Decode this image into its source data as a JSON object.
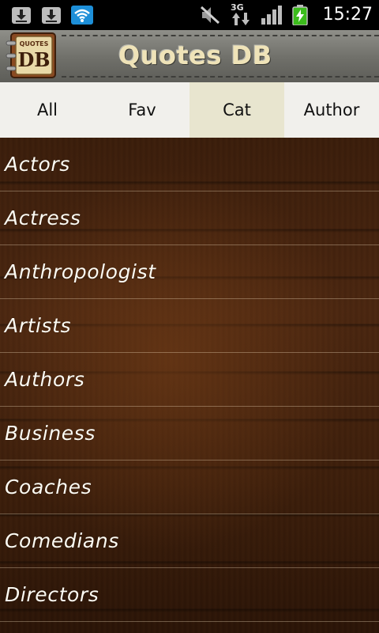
{
  "status_bar": {
    "time": "15:27",
    "network_label": "3G",
    "icons": [
      "download-icon",
      "download-icon",
      "wifi-icon",
      "mute-icon",
      "data-arrows-icon",
      "signal-icon",
      "battery-charging-icon"
    ]
  },
  "header": {
    "title": "Quotes DB",
    "logo_text_top": "QUOTES",
    "logo_text_main": "DB"
  },
  "tabs": [
    {
      "label": "All",
      "selected": false
    },
    {
      "label": "Fav",
      "selected": false
    },
    {
      "label": "Cat",
      "selected": true
    },
    {
      "label": "Author",
      "selected": false
    }
  ],
  "categories": [
    "Actors",
    "Actress",
    "Anthropologist",
    "Artists",
    "Authors",
    "Business",
    "Coaches",
    "Comedians",
    "Directors"
  ],
  "colors": {
    "tab_selected_bg": "#e8e5cf",
    "title_color": "#efe3b8"
  }
}
